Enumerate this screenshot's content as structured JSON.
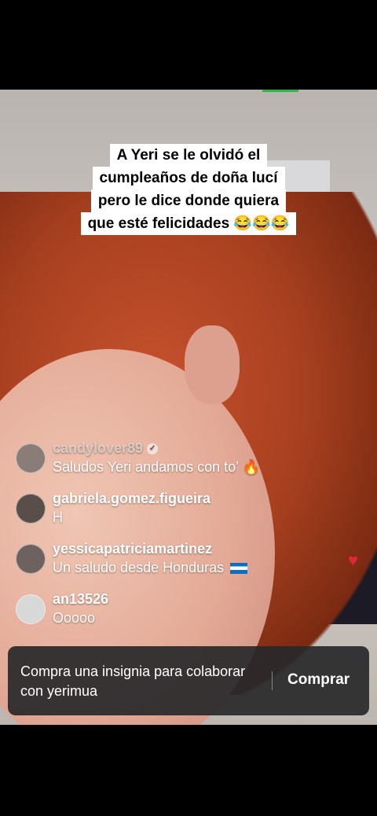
{
  "caption": {
    "lines": [
      "A Yeri se le olvidó el",
      "cumpleaños de doña lucí",
      "pero le dice donde quiera",
      "que esté felicidades 😂😂😂"
    ]
  },
  "comments": [
    {
      "user": "candylover89",
      "text": "Saludos Yeri andamos con to’ 🔥",
      "verified": true
    },
    {
      "user": "gabriela.gomez.figueira",
      "text": "H"
    },
    {
      "user": "yessicapatriciamartinez",
      "text": "Un saludo  desde  Honduras"
    },
    {
      "user": "an13526",
      "text": "Ooooo"
    }
  ],
  "badge": {
    "text": "Compra una insignia para colaborar con yerimua",
    "button": "Comprar"
  },
  "icons": {
    "heart": "heart-icon",
    "verified": "verified-icon",
    "flag": "honduras-flag-icon"
  },
  "colors": {
    "heart": "#e0263a",
    "badge_bg": "#28282a"
  }
}
